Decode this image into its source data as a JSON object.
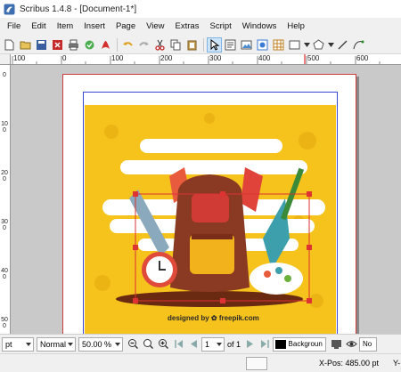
{
  "window": {
    "title": "Scribus 1.4.8 - [Document-1*]"
  },
  "menu": [
    "File",
    "Edit",
    "Item",
    "Insert",
    "Page",
    "View",
    "Extras",
    "Script",
    "Windows",
    "Help"
  ],
  "ruler": {
    "h": [
      "100",
      "0",
      "100",
      "200",
      "300",
      "400",
      "500",
      "600"
    ],
    "v": [
      "0",
      "100",
      "200",
      "300",
      "400",
      "500"
    ]
  },
  "page": {
    "credit": "designed by ✿ freepik.com"
  },
  "status": {
    "unit": "pt",
    "mode": "Normal",
    "zoom": "50.00 %",
    "page": "1",
    "of_pages": "of 1",
    "layer": "Background",
    "appearance": "No"
  },
  "coords": {
    "x": "X-Pos:  485.00 pt",
    "y_label": "Y-"
  },
  "colors": {
    "artwork_background": "#f6c21c",
    "selection_frame": "#dd3333",
    "margin_guide": "#3a46d6"
  }
}
